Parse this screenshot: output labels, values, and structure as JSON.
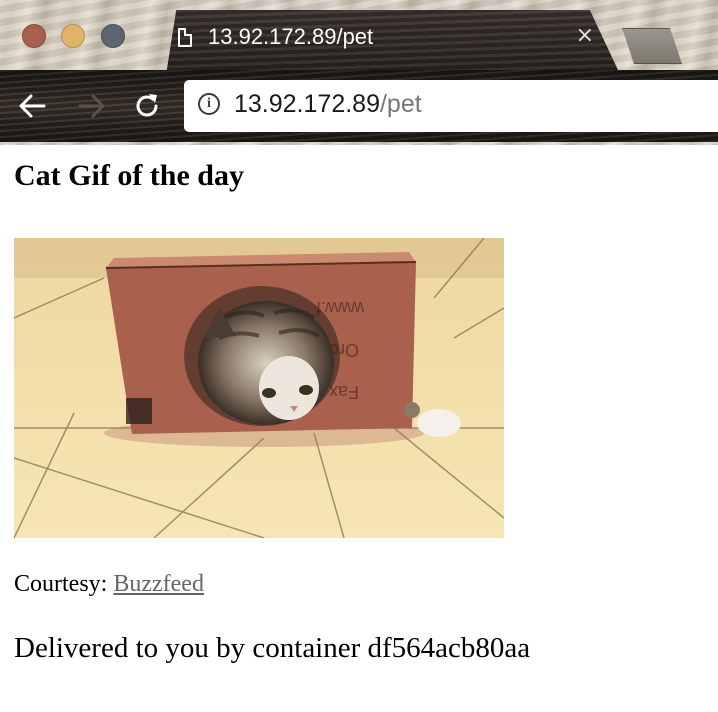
{
  "window": {
    "traffic_lights": [
      "close",
      "minimize",
      "zoom"
    ]
  },
  "tab": {
    "title": "13.92.172.89/pet",
    "icon": "document-icon",
    "close_label": "×"
  },
  "toolbar": {
    "back_icon": "arrow-left-icon",
    "forward_icon": "arrow-right-icon",
    "reload_icon": "reload-icon"
  },
  "omnibox": {
    "info_icon": "info-icon",
    "info_glyph": "i",
    "url_host": "13.92.172.89",
    "url_path": "/pet"
  },
  "page": {
    "title": "Cat Gif of the day",
    "image_alt_name": "cat-in-box-gif",
    "box_print_text": [
      "www.f",
      "Orde",
      "Fax"
    ],
    "courtesy_prefix": "Courtesy:",
    "courtesy_link": "Buzzfeed",
    "delivered_text": "Delivered to you by container df564acb80aa"
  },
  "colors": {
    "traffic_red": "#a8604c",
    "traffic_yellow": "#e0b466",
    "traffic_green": "#5d6670",
    "link": "#666666",
    "floor": "#f3e0a8",
    "box": "#a9604d"
  }
}
